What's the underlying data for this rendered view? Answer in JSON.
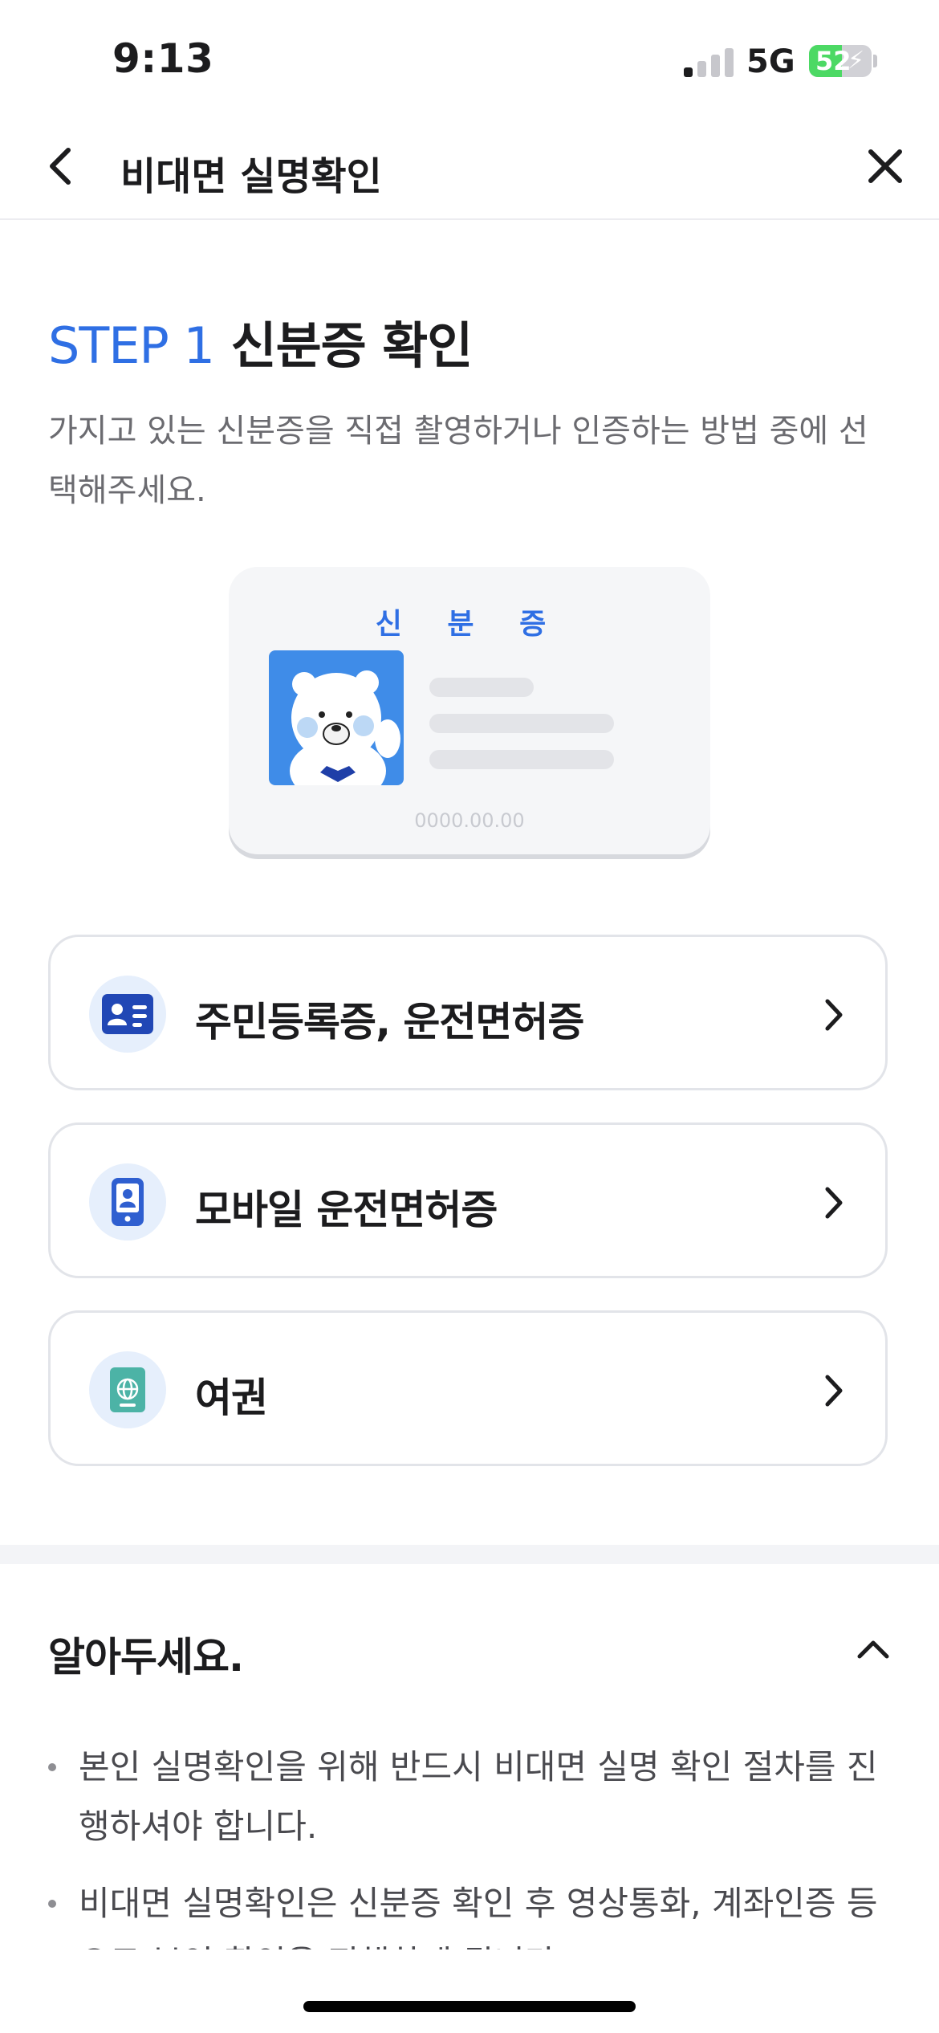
{
  "status_bar": {
    "time": "9:13",
    "network": "5G",
    "battery_percent": "52",
    "battery_level": 0.52,
    "signal_bars_active": 1,
    "charging": true
  },
  "nav": {
    "title": "비대면 실명확인",
    "back_icon": "chevron-left-icon",
    "close_icon": "close-icon"
  },
  "step": {
    "label": "STEP 1",
    "title": "신분증 확인",
    "description": "가지고 있는 신분증을 직접 촬영하거나 인증하는 방법 중에 선택해주세요.",
    "accent_color": "#2f6fe4"
  },
  "id_card": {
    "title": "신 분 증",
    "number_placeholder": "0000.00.00",
    "photo_icon": "polar-bear-mascot-icon"
  },
  "options": [
    {
      "label": "주민등록증, 운전면허증",
      "icon": "id-card-icon"
    },
    {
      "label": "모바일 운전면허증",
      "icon": "mobile-id-icon"
    },
    {
      "label": "여권",
      "icon": "passport-icon"
    }
  ],
  "notice": {
    "title": "알아두세요.",
    "expanded": true,
    "items": [
      "본인 실명확인을 위해 반드시 비대면 실명 확인 절차를 진행하셔야 합니다.",
      "비대면 실명확인은 신분증 확인 후 영상통화, 계좌인증 등으로 본인 확인을 진행하게 됩니다."
    ]
  }
}
